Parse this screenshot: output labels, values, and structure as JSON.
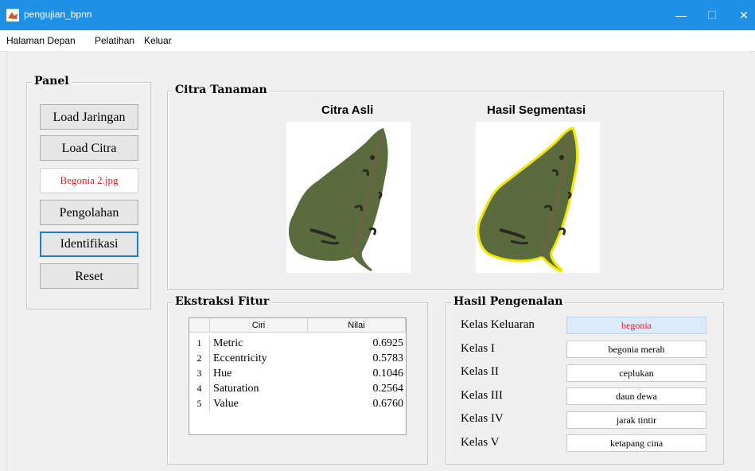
{
  "window": {
    "title": "pengujian_bpnn",
    "controls": {
      "minimize": "—",
      "maximize": "☐",
      "close": "✕"
    }
  },
  "menu": [
    "Halaman Depan",
    "Pelatihan",
    "Keluar"
  ],
  "panel": {
    "title": "Panel",
    "buttons": {
      "load_jaringan": "Load Jaringan",
      "load_citra": "Load Citra",
      "pengolahan": "Pengolahan",
      "identifikasi": "Identifikasi",
      "reset": "Reset"
    },
    "file_name": "Begonia 2.jpg"
  },
  "citra": {
    "title": "Citra Tanaman",
    "asli_title": "Citra Asli",
    "segmentasi_title": "Hasil Segmentasi"
  },
  "ekstraksi": {
    "title": "Ekstraksi Fitur",
    "headers": [
      "Ciri",
      "Nilai"
    ],
    "rows": [
      {
        "no": "1",
        "ciri": "Metric",
        "nilai": "0.6925"
      },
      {
        "no": "2",
        "ciri": "Eccentricity",
        "nilai": "0.5783"
      },
      {
        "no": "3",
        "ciri": "Hue",
        "nilai": "0.1046"
      },
      {
        "no": "4",
        "ciri": "Saturation",
        "nilai": "0.2564"
      },
      {
        "no": "5",
        "ciri": "Value",
        "nilai": "0.6760"
      }
    ]
  },
  "hasil": {
    "title": "Hasil Pengenalan",
    "items": [
      {
        "label": "Kelas Keluaran",
        "value": "begonia"
      },
      {
        "label": "Kelas I",
        "value": "begonia merah"
      },
      {
        "label": "Kelas II",
        "value": "ceplukan"
      },
      {
        "label": "Kelas III",
        "value": "daun dewa"
      },
      {
        "label": "Kelas IV",
        "value": "jarak tintir"
      },
      {
        "label": "Kelas V",
        "value": "ketapang cina"
      }
    ]
  },
  "colors": {
    "titlebar": "#1e90e6",
    "output_text": "#e21d1d",
    "output_bg": "#dbeafc",
    "leaf": "#5a6b3e",
    "segment_outline": "#f5e600"
  }
}
